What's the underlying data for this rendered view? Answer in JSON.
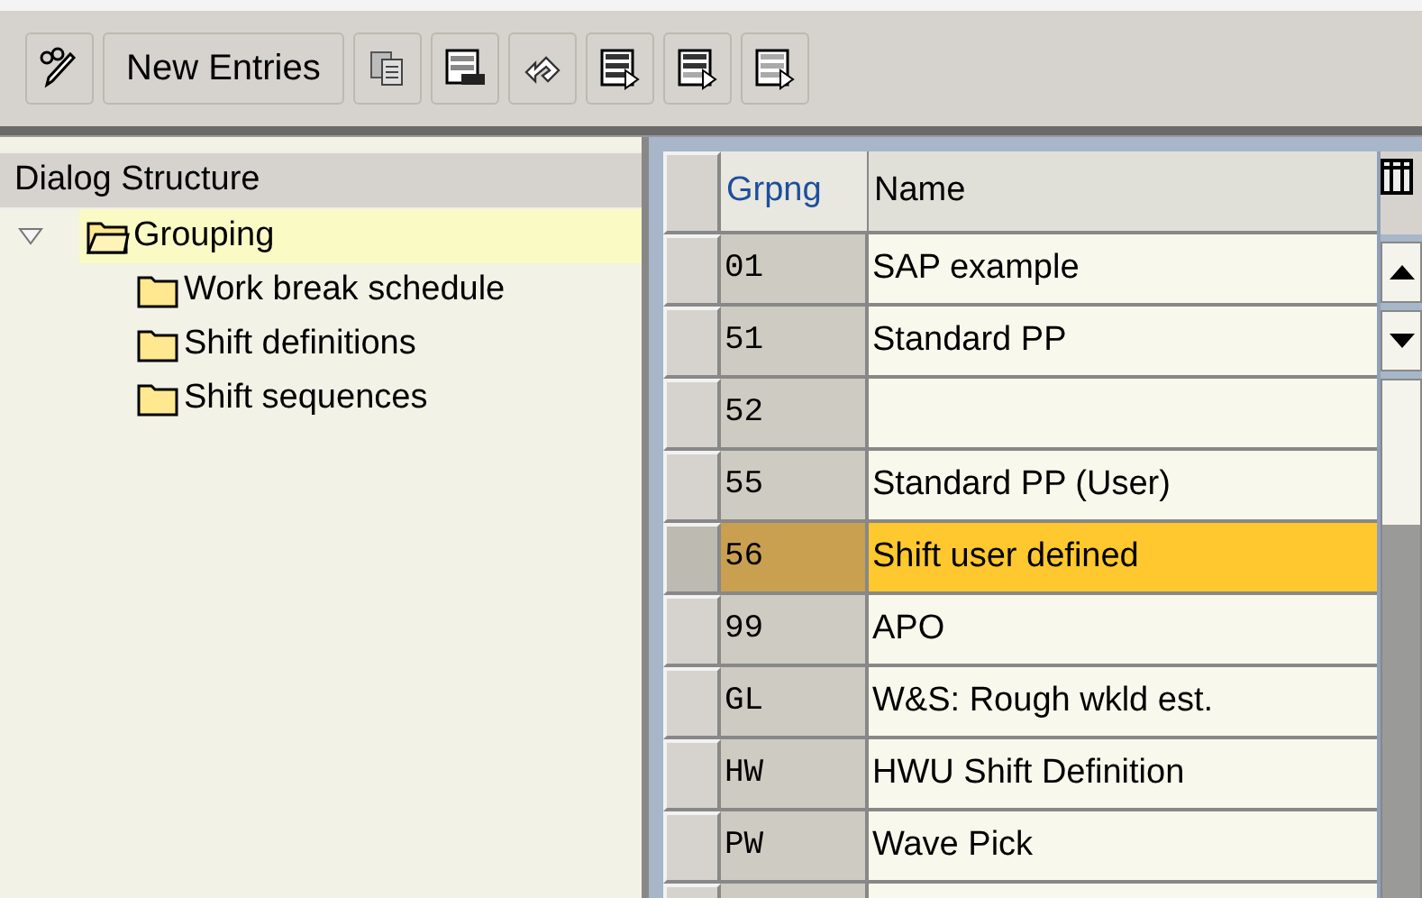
{
  "toolbar": {
    "buttons": [
      {
        "kind": "display-change"
      },
      {
        "kind": "text",
        "label": "New Entries"
      },
      {
        "kind": "copy"
      },
      {
        "kind": "delete"
      },
      {
        "kind": "undo"
      },
      {
        "kind": "select-all"
      },
      {
        "kind": "select-block"
      },
      {
        "kind": "deselect-all"
      }
    ]
  },
  "dialog_structure": {
    "title": "Dialog Structure",
    "items": [
      {
        "label": "Grouping",
        "expanded": true,
        "selected": true,
        "children": [
          {
            "label": "Work break schedule",
            "selected": false
          },
          {
            "label": "Shift definitions",
            "selected": false
          },
          {
            "label": "Shift sequences",
            "selected": false
          }
        ]
      }
    ]
  },
  "table": {
    "columns": [
      "Grpng",
      "Name"
    ],
    "rows": [
      {
        "key": "01",
        "name": "SAP example",
        "selected": false
      },
      {
        "key": "51",
        "name": "Standard PP",
        "selected": false
      },
      {
        "key": "52",
        "name": "",
        "selected": false
      },
      {
        "key": "55",
        "name": "Standard PP (User)",
        "selected": false
      },
      {
        "key": "56",
        "name": "Shift user defined",
        "selected": true
      },
      {
        "key": "99",
        "name": "APO",
        "selected": false
      },
      {
        "key": "GL",
        "name": "W&S: Rough wkld est.",
        "selected": false
      },
      {
        "key": "HW",
        "name": "HWU Shift Definition",
        "selected": false
      },
      {
        "key": "PW",
        "name": "Wave Pick",
        "selected": false
      }
    ]
  }
}
